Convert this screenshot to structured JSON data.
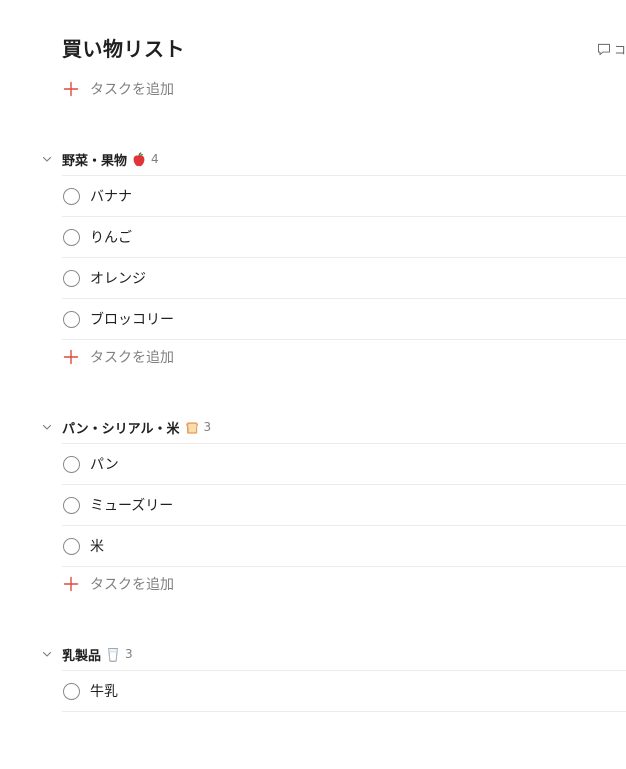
{
  "page": {
    "title": "買い物リスト",
    "comment_label": "コ"
  },
  "add_task_label": "タスクを追加",
  "sections": [
    {
      "name": "野菜・果物",
      "emoji": "apple-icon",
      "count": "4",
      "tasks": [
        "バナナ",
        "りんご",
        "オレンジ",
        "ブロッコリー"
      ]
    },
    {
      "name": "パン・シリアル・米",
      "emoji": "bread-icon",
      "count": "3",
      "tasks": [
        "パン",
        "ミューズリー",
        "米"
      ]
    },
    {
      "name": "乳製品",
      "emoji": "milk-glass-icon",
      "count": "3",
      "tasks": [
        "牛乳"
      ]
    }
  ],
  "colors": {
    "accent": "#dc4c3e",
    "text": "#202020",
    "muted": "#808080",
    "divider": "#ebebeb"
  }
}
